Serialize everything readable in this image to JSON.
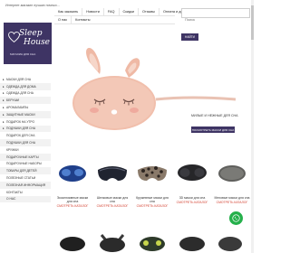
{
  "header": {
    "top_line": "Интернет-магазин лучших ночных...",
    "logo_line1": "Sleep",
    "logo_line2": "House",
    "logo_slogan": "МАГАЗИН ДЛЯ СНА"
  },
  "nav": {
    "row1": [
      "Как заказать",
      "Новости",
      "FAQ",
      "Скидки",
      "Отзывы",
      "Оплата и доставка"
    ],
    "row2": [
      "О нас",
      "Контакты"
    ]
  },
  "search": {
    "placeholder": "Поиск",
    "button_label": "НАЙТИ"
  },
  "sidebar": {
    "items": [
      {
        "label": "МАСКИ ДЛЯ СНА",
        "arrow": "▸"
      },
      {
        "label": "ОДЕЖДА ДЛЯ ДОМА",
        "arrow": "▸"
      },
      {
        "label": "ОДЕЖДА ДЛЯ СНА",
        "arrow": "▸"
      },
      {
        "label": "БЕРУШИ",
        "arrow": "▸"
      },
      {
        "label": "АРОМАЛАМПЫ",
        "arrow": "▸"
      },
      {
        "label": "ЗАЩИТНЫЕ МАСКИ",
        "arrow": "▸"
      },
      {
        "label": "ПОДАРОК НА УТРО",
        "arrow": "▸"
      },
      {
        "label": "ПОДУШКИ ДЛЯ СНА",
        "arrow": "▸"
      },
      {
        "label": "ПОДАРОК ДЛЯ СНА",
        "arrow": ""
      },
      {
        "label": "ПОДУШКИ ДЛЯ СНА",
        "arrow": ""
      },
      {
        "label": "КРУЖКИ",
        "arrow": ""
      },
      {
        "label": "ПОДАРОЧНЫЕ КАРТЫ",
        "arrow": ""
      },
      {
        "label": "ПОДАРОЧНЫЕ НАБОРЫ",
        "arrow": ""
      },
      {
        "label": "ТОВАРЫ ДЛЯ ДЕТЕЙ",
        "arrow": ""
      },
      {
        "label": "ПОЛЕЗНЫЕ СТАТЬИ",
        "arrow": ""
      },
      {
        "label": "ПОЛЕЗНАЯ ИНФОРМАЦИЯ",
        "arrow": ""
      },
      {
        "label": "КОНТАКТЫ",
        "arrow": ""
      },
      {
        "label": "О НАС",
        "arrow": ""
      }
    ]
  },
  "hero": {
    "title": "МИЛЫЕ И НЕЖНЫЕ ДЛЯ СНА",
    "button_label": "ПОСМОТРЕТЬ МАСКИ ДЛЯ СНА"
  },
  "products": [
    {
      "title": "Эксклюзивные маски для сна",
      "price": "СМОТРЕТЬ КАТАЛОГ"
    },
    {
      "title": "Шелковые маски для сна",
      "price": "СМОТРЕТЬ КАТАЛОГ"
    },
    {
      "title": "Кружевные маски для сна",
      "price": "СМОТРЕТЬ КАТАЛОГ"
    },
    {
      "title": "3D маски для сна",
      "price": "СМОТРЕТЬ КАТАЛОГ"
    },
    {
      "title": "Меховые маски для сна",
      "price": "СМОТРЕТЬ КАТАЛОГ"
    }
  ],
  "colors": {
    "brand": "#3e3464",
    "whatsapp": "#25b04b",
    "price": "#d23b2a"
  }
}
